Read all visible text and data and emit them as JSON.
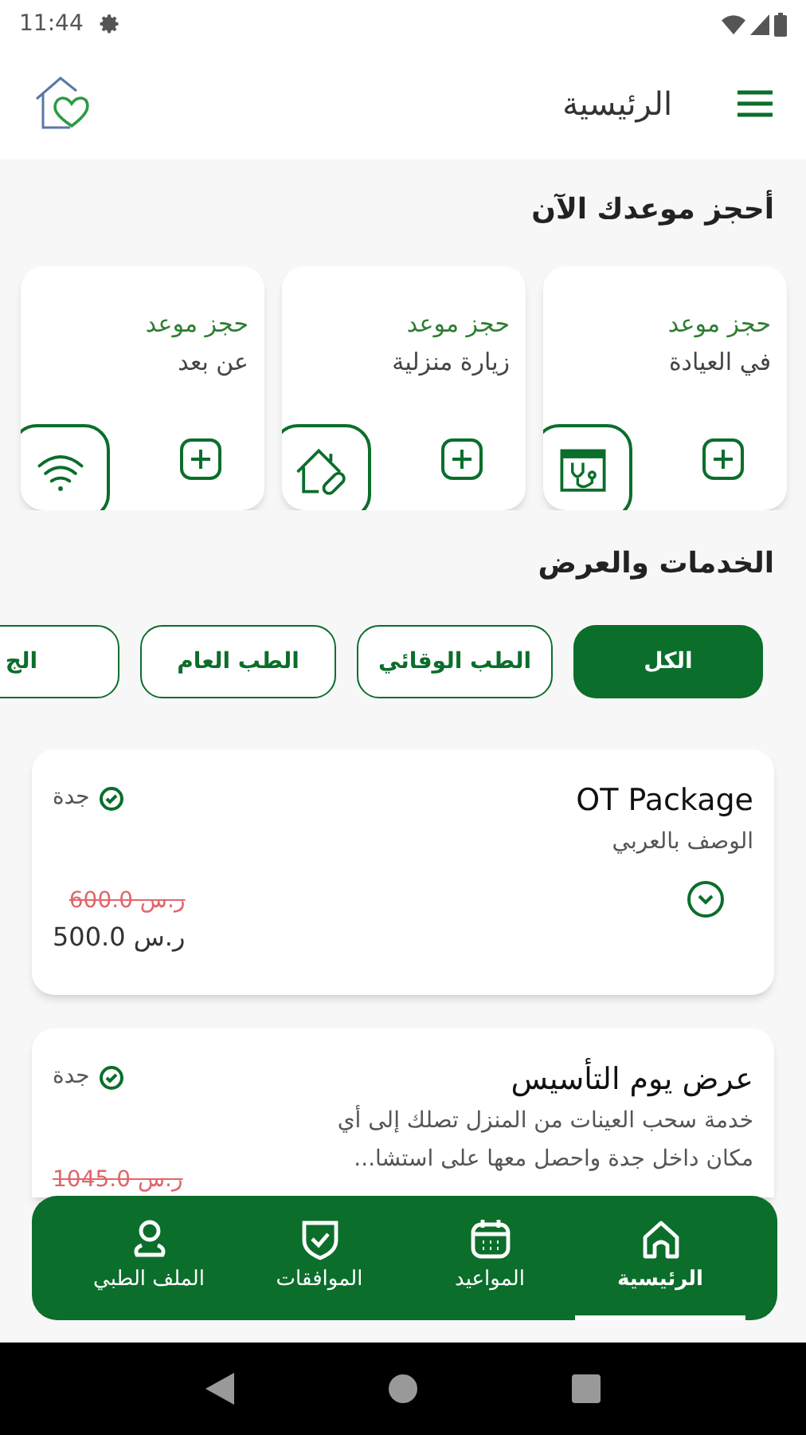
{
  "status_bar": {
    "time": "11:44"
  },
  "header": {
    "title": "الرئيسية"
  },
  "booking": {
    "title": "أحجز موعدك الآن",
    "cards": [
      {
        "line1": "حجز موعد",
        "line2": "في العيادة",
        "kind": "clinic"
      },
      {
        "line1": "حجز موعد",
        "line2": "زيارة منزلية",
        "kind": "home"
      },
      {
        "line1": "حجز موعد",
        "line2": "عن بعد",
        "kind": "remote"
      }
    ]
  },
  "services": {
    "title": "الخدمات والعرض",
    "filters": [
      {
        "label": "الكل",
        "selected": true
      },
      {
        "label": "الطب الوقائي",
        "selected": false
      },
      {
        "label": "الطب العام",
        "selected": false
      },
      {
        "label": "الج",
        "selected": false
      }
    ],
    "items": [
      {
        "title": "OT Package",
        "description": "الوصف بالعربي",
        "city": "جدة",
        "old_price": "ر.س 600.0",
        "price": "ر.س 500.0",
        "expand_icon": true
      },
      {
        "title": "عرض يوم التأسيس",
        "description": "خدمة سحب العينات من المنزل تصلك إلى أي مكان داخل جدة واحصل معها على استشا...",
        "city": "جدة",
        "old_price": "ر.س 1045.0"
      }
    ]
  },
  "bottom_nav": [
    {
      "label": "الرئيسية",
      "kind": "home",
      "selected": true
    },
    {
      "label": "المواعيد",
      "kind": "calendar",
      "selected": false
    },
    {
      "label": "الموافقات",
      "kind": "shield",
      "selected": false
    },
    {
      "label": "الملف الطبي",
      "kind": "person",
      "selected": false
    }
  ]
}
